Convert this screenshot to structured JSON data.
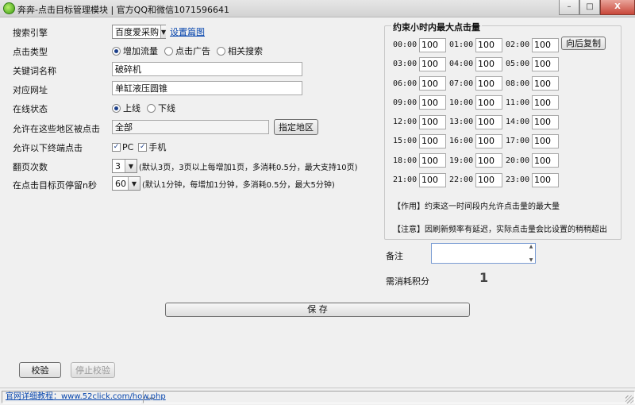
{
  "window": {
    "title": "奔奔-点击目标管理模块 | 官方QQ和微信1071596641",
    "minimize": "–",
    "maximize": "□",
    "close": "X"
  },
  "form": {
    "engine": {
      "label": "搜索引擎",
      "value": "百度爱采购",
      "link": "设置篇图"
    },
    "click_type": {
      "label": "点击类型",
      "options": [
        "增加流量",
        "点击广告",
        "相关搜索"
      ],
      "selected_index": 0
    },
    "keyword": {
      "label": "关键词名称",
      "value": "破碎机"
    },
    "url": {
      "label": "对应网址",
      "value": "单缸液压圆锥"
    },
    "status": {
      "label": "在线状态",
      "options": [
        "上线",
        "下线"
      ],
      "selected_index": 0
    },
    "region": {
      "label": "允许在这些地区被点击",
      "value": "全部",
      "button": "指定地区"
    },
    "devices": {
      "label": "允许以下终端点击",
      "options": [
        "PC",
        "手机"
      ],
      "checked": [
        true,
        true
      ]
    },
    "pages": {
      "label": "翻页次数",
      "value": "3",
      "hint": "(默认3页，3页以上每增加1页，多消耗0.5分，最大支持10页)"
    },
    "stay": {
      "label": "在点击目标页停留n秒",
      "value": "60",
      "hint": "(默认1分钟，每增加1分钟，多消耗0.5分，最大5分钟)"
    },
    "save_button": "保 存",
    "verify_button": "校验",
    "stop_verify_button": "停止校验"
  },
  "hourly": {
    "title": "约束小时内最大点击量",
    "copy_button": "向后复制",
    "hours": [
      {
        "label": "00:00",
        "value": "100"
      },
      {
        "label": "01:00",
        "value": "100"
      },
      {
        "label": "02:00",
        "value": "100"
      },
      {
        "label": "03:00",
        "value": "100"
      },
      {
        "label": "04:00",
        "value": "100"
      },
      {
        "label": "05:00",
        "value": "100"
      },
      {
        "label": "06:00",
        "value": "100"
      },
      {
        "label": "07:00",
        "value": "100"
      },
      {
        "label": "08:00",
        "value": "100"
      },
      {
        "label": "09:00",
        "value": "100"
      },
      {
        "label": "10:00",
        "value": "100"
      },
      {
        "label": "11:00",
        "value": "100"
      },
      {
        "label": "12:00",
        "value": "100"
      },
      {
        "label": "13:00",
        "value": "100"
      },
      {
        "label": "14:00",
        "value": "100"
      },
      {
        "label": "15:00",
        "value": "100"
      },
      {
        "label": "16:00",
        "value": "100"
      },
      {
        "label": "17:00",
        "value": "100"
      },
      {
        "label": "18:00",
        "value": "100"
      },
      {
        "label": "19:00",
        "value": "100"
      },
      {
        "label": "20:00",
        "value": "100"
      },
      {
        "label": "21:00",
        "value": "100"
      },
      {
        "label": "22:00",
        "value": "100"
      },
      {
        "label": "23:00",
        "value": "100"
      }
    ],
    "note_effect": "【作用】约束这一时间段内允许点击量的最大量",
    "note_warning": "【注意】因刷新频率有延迟，实际点击量会比设置的稍稍超出"
  },
  "remark": {
    "label": "备注",
    "value": ""
  },
  "cost": {
    "label": "需消耗积分",
    "value": "1"
  },
  "statusbar": {
    "tutorial": "官网详细教程：www.52click.com/how.php",
    "extra": "..."
  }
}
